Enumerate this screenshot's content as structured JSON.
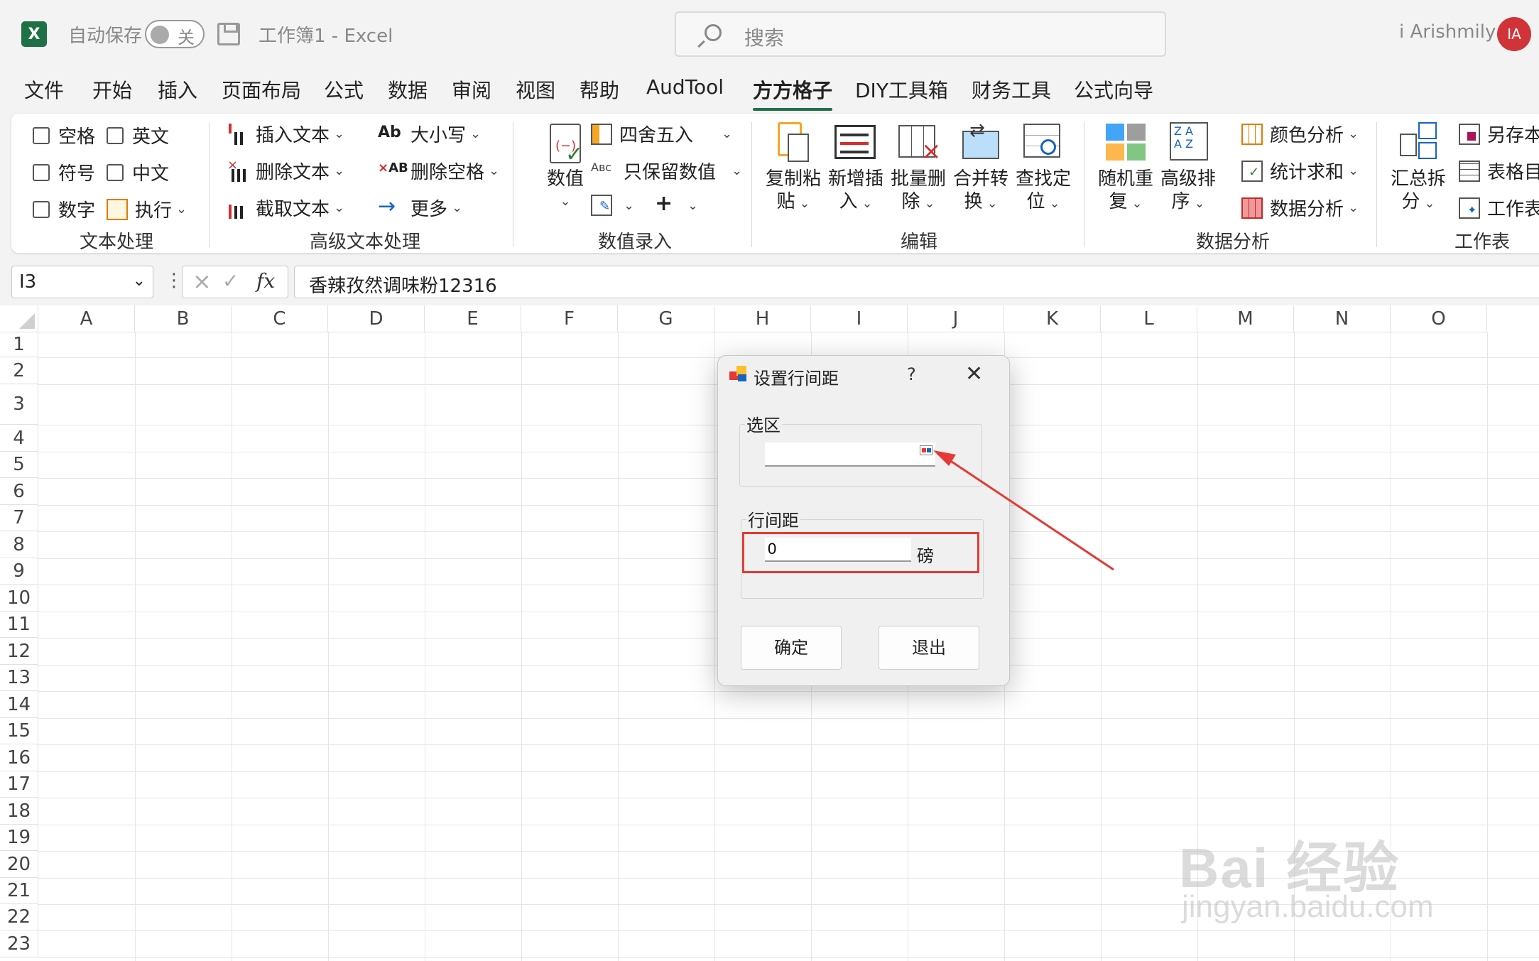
{
  "titlebar": {
    "app_icon": "X",
    "autosave_label": "自动保存",
    "autosave_state": "关",
    "doc_title": "工作簿1  -  Excel",
    "search_placeholder": "搜索",
    "user_name": "i Arishmily",
    "avatar_initials": "IA"
  },
  "menu": {
    "tabs": [
      "文件",
      "开始",
      "插入",
      "页面布局",
      "公式",
      "数据",
      "审阅",
      "视图",
      "帮助",
      "AudTool",
      "方方格子",
      "DIY工具箱",
      "财务工具",
      "公式向导"
    ],
    "active": "方方格子"
  },
  "ribbon": {
    "text_processing": {
      "label": "文本处理",
      "items": [
        "空格",
        "英文",
        "符号",
        "中文",
        "数字",
        "执行"
      ]
    },
    "advanced_text": {
      "label": "高级文本处理",
      "items": [
        "插入文本",
        "删除文本",
        "截取文本",
        "大小写",
        "删除空格",
        "更多"
      ]
    },
    "value_entry": {
      "label": "数值录入",
      "big_button": "数值",
      "items": [
        "四舍五入",
        "只保留数值"
      ]
    },
    "edit": {
      "label": "编辑",
      "buttons": [
        {
          "l1": "复制粘",
          "l2": "贴"
        },
        {
          "l1": "新增插",
          "l2": "入"
        },
        {
          "l1": "批量删",
          "l2": "除"
        },
        {
          "l1": "合并转",
          "l2": "换"
        },
        {
          "l1": "查找定",
          "l2": "位"
        }
      ]
    },
    "data_analysis": {
      "label": "数据分析",
      "buttons": [
        {
          "l1": "随机重",
          "l2": "复"
        },
        {
          "l1": "高级排",
          "l2": "序"
        }
      ],
      "items": [
        "颜色分析",
        "统计求和",
        "数据分析"
      ]
    },
    "worksheet": {
      "label": "工作表",
      "big": {
        "l1": "汇总拆",
        "l2": "分"
      },
      "items": [
        "另存本",
        "表格目",
        "工作表"
      ]
    }
  },
  "formula_bar": {
    "name_box": "I3",
    "content": "香辣孜然调味粉12316"
  },
  "sheet": {
    "columns": [
      "A",
      "B",
      "C",
      "D",
      "E",
      "F",
      "G",
      "H",
      "I",
      "J",
      "K",
      "L",
      "M",
      "N",
      "O"
    ],
    "rows": [
      "1",
      "2",
      "3",
      "4",
      "5",
      "6",
      "7",
      "8",
      "9",
      "10",
      "11",
      "12",
      "13",
      "14",
      "15",
      "16",
      "17",
      "18",
      "19",
      "20",
      "21",
      "22",
      "23"
    ]
  },
  "dialog": {
    "title": "设置行间距",
    "help": "?",
    "selection_label": "选区",
    "selection_value": "",
    "spacing_label": "行间距",
    "spacing_value": "0",
    "unit": "磅",
    "ok": "确定",
    "exit": "退出"
  },
  "watermark": {
    "line1": "Bai 经验",
    "line2": "jingyan.baidu.com"
  },
  "colors": {
    "excel_green": "#1e7145",
    "annotation_red": "#e53935",
    "avatar_red": "#d13438"
  }
}
